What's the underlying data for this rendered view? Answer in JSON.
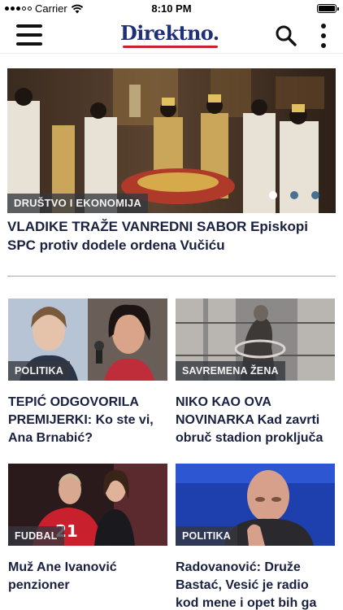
{
  "status_bar": {
    "carrier": "Carrier",
    "time": "8:10 PM"
  },
  "header": {
    "logo": "Direktno."
  },
  "hero": {
    "category": "DRUŠTVO I EKONOMIJA",
    "title": "VLADIKE TRAŽE VANREDNI SABOR Episkopi SPC protiv dodele ordena Vučiću",
    "slides": 3,
    "active_slide": 1
  },
  "articles": [
    {
      "category": "POLITIKA",
      "title": "TEPIĆ ODGOVORILA PREMIJERKI: Ko ste vi, Ana Brnabić?"
    },
    {
      "category": "SAVREMENA ŽENA",
      "title": " NIKO KAO OVA NOVINARKA Kad zavrti obruč stadion proključa"
    },
    {
      "category": "FUDBAL",
      "title": "Muž Ane Ivanović penzioner"
    },
    {
      "category": "POLITIKA",
      "title": "Radovanović: Druže Bastać, Vesić je radio kod mene i opet bih ga zapo..."
    }
  ],
  "colors": {
    "logo": "#1f2f78",
    "logo_underline": "#c8202c",
    "tag_background": "#34373e",
    "title": "#1a2040"
  },
  "icons": [
    "hamburger-menu-icon",
    "search-icon",
    "more-vertical-icon",
    "wifi-icon",
    "battery-icon"
  ]
}
